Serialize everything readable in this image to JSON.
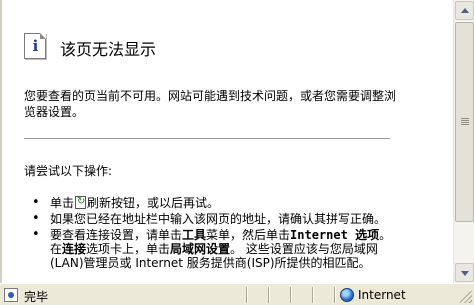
{
  "page": {
    "icon_letter": "i",
    "title": "该页无法显示",
    "description": "您要查看的页当前不可用。网站可能遇到技术问题，或者您需要调整浏览器设置。",
    "try_heading": "请尝试以下操作:",
    "steps": [
      {
        "before": "单击",
        "after": "刷新按钮，或以后再试。"
      },
      {
        "text": "如果您已经在地址栏中输入该网页的地址，请确认其拼写正确。"
      },
      {
        "p1": "要查看连接设置，请单击",
        "b1": "工具",
        "p2": "菜单，然后单击",
        "b2": "Internet 选项",
        "p3": "。在",
        "b3": "连接",
        "p4": "选项卡上，单击",
        "b4": "局域网设置",
        "p5": "。 这些设置应该与您局域网(LAN)管理员或 Internet 服务提供商(ISP)所提供的相匹配。"
      }
    ]
  },
  "statusbar": {
    "status": "完毕",
    "zone": "Internet"
  }
}
